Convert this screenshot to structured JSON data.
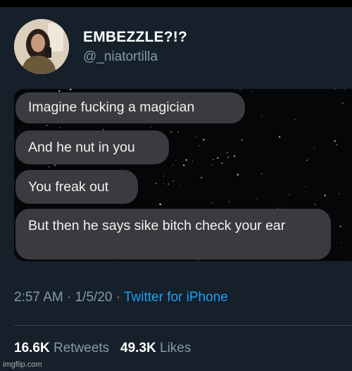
{
  "tweet": {
    "display_name": "EMBEZZLE?!?",
    "handle": "@_niatortilla",
    "messages": [
      "Imagine fucking a magician",
      "And he nut in you",
      "You freak out",
      "But then he says sike bitch check your ear"
    ],
    "time": "2:57 AM",
    "date": "1/5/20",
    "separator": "·",
    "source": "Twitter for iPhone",
    "retweets_count": "16.6K",
    "retweets_label": "Retweets",
    "likes_count": "49.3K",
    "likes_label": "Likes"
  },
  "watermark": "imgflip.com",
  "colors": {
    "background": "#15202b",
    "secondary_text": "#8899a6",
    "link": "#1da1f2",
    "bubble": "#3a3b3e"
  }
}
